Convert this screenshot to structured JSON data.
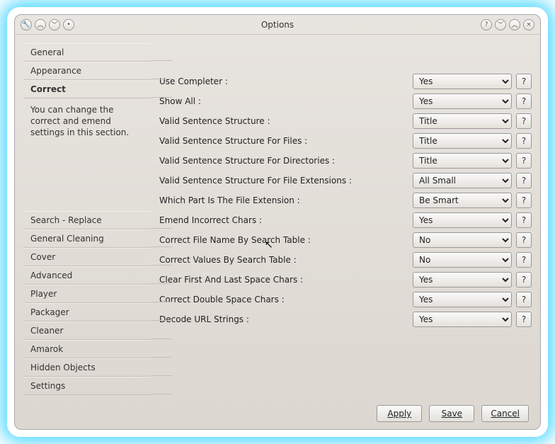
{
  "title": "Options",
  "toolIcons": [
    "wrench-icon",
    "up-icon",
    "down-icon",
    "dot-icon"
  ],
  "winIcons": [
    "help-icon",
    "minimize-icon",
    "maximize-icon",
    "close-icon"
  ],
  "sidebar": {
    "groupA": [
      {
        "label": "General"
      },
      {
        "label": "Appearance"
      },
      {
        "label": "Correct",
        "active": true
      }
    ],
    "desc": "You can change the correct and emend settings in this section.",
    "groupB": [
      {
        "label": "Search - Replace"
      },
      {
        "label": "General Cleaning"
      },
      {
        "label": "Cover"
      },
      {
        "label": "Advanced"
      },
      {
        "label": "Player"
      },
      {
        "label": "Packager"
      },
      {
        "label": "Cleaner"
      },
      {
        "label": "Amarok"
      },
      {
        "label": "Hidden Objects"
      },
      {
        "label": "Settings"
      }
    ]
  },
  "rows": [
    {
      "label": "Use Completer :",
      "value": "Yes"
    },
    {
      "label": "Show All :",
      "value": "Yes"
    },
    {
      "label": "Valid Sentence Structure :",
      "value": "Title"
    },
    {
      "label": "Valid Sentence Structure For Files :",
      "value": "Title"
    },
    {
      "label": "Valid Sentence Structure For Directories :",
      "value": "Title"
    },
    {
      "label": "Valid Sentence Structure For File Extensions :",
      "value": "All Small"
    },
    {
      "label": "Which Part Is The File Extension :",
      "value": "Be Smart"
    },
    {
      "label": "Emend Incorrect Chars :",
      "value": "Yes"
    },
    {
      "label": "Correct File Name By Search Table :",
      "value": "No"
    },
    {
      "label": "Correct Values By Search Table :",
      "value": "No"
    },
    {
      "label": "Clear First And Last Space Chars :",
      "value": "Yes"
    },
    {
      "label": "Correct Double Space Chars :",
      "value": "Yes"
    },
    {
      "label": "Decode URL Strings :",
      "value": "Yes"
    }
  ],
  "buttons": {
    "apply": "Apply",
    "save": "Save",
    "cancel": "Cancel"
  },
  "helpGlyph": "?",
  "toolGlyphs": {
    "wrench-icon": "🔧",
    "up-icon": "︿",
    "down-icon": "﹀",
    "dot-icon": "•",
    "help-icon": "?",
    "minimize-icon": "﹀",
    "maximize-icon": "︿",
    "close-icon": "×"
  }
}
